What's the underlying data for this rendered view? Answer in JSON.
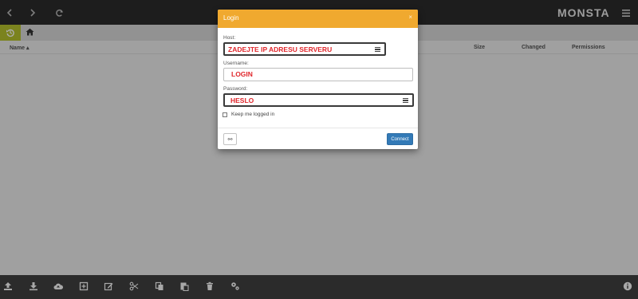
{
  "app": {
    "logo_text": "MONSTA"
  },
  "file_list": {
    "columns": {
      "name": "Name ▴",
      "size": "Size",
      "changed": "Changed",
      "permissions": "Permissions"
    }
  },
  "login_dialog": {
    "title": "Login",
    "close": "×",
    "host_label": "Host:",
    "host_value": "ZADEJTE IP ADRESU SERVERU",
    "username_label": "Username:",
    "username_value": "LOGIN",
    "password_label": "Password:",
    "password_value": "HESLO",
    "remember_label": "Keep me logged in",
    "remember_checked": false,
    "advanced_button": "⚯",
    "connect_button": "Connect"
  },
  "colors": {
    "toolbar_bg": "#2b2b2b",
    "accent_history": "#b6c12d",
    "dialog_header": "#f0a92f",
    "connect_button": "#337ab7",
    "annotation_red": "#e0262b"
  },
  "icons": {
    "top_toolbar": [
      "chevron-left-icon",
      "chevron-right-icon",
      "refresh-icon",
      "hamburger-menu-icon"
    ],
    "bottom_toolbar": [
      "upload-icon",
      "download-icon",
      "cloud-upload-icon",
      "new-item-icon",
      "edit-icon",
      "cut-icon",
      "copy-icon",
      "paste-icon",
      "delete-icon",
      "settings-icon",
      "info-icon"
    ]
  }
}
